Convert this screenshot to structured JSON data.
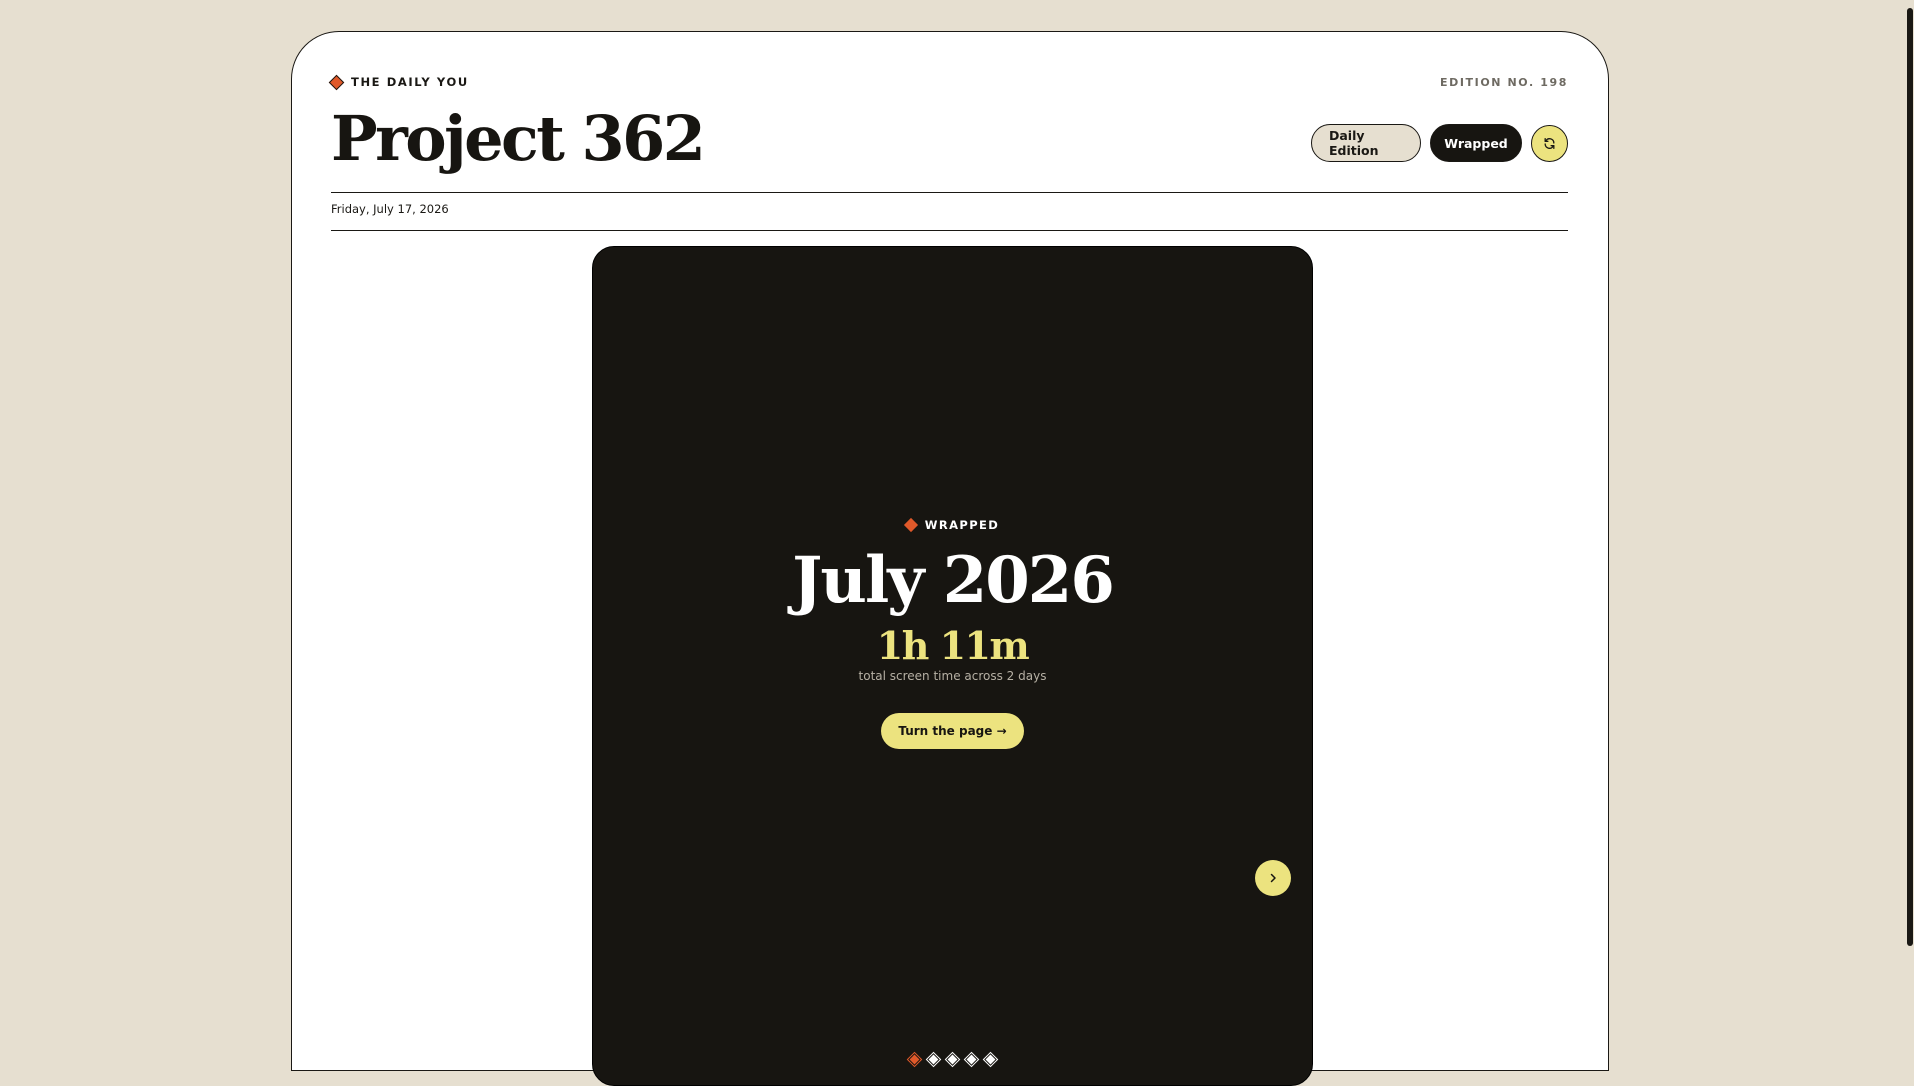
{
  "masthead": {
    "brand": "THE DAILY YOU",
    "edition": "EDITION NO. 198",
    "title": "Project 362",
    "date": "Friday, July 17, 2026"
  },
  "controls": {
    "daily_label": "Daily Edition",
    "wrapped_label": "Wrapped",
    "refresh_icon": "refresh-icon"
  },
  "card": {
    "eyebrow": "WRAPPED",
    "month": "July 2026",
    "total_time": "1h 11m",
    "subtext": "total screen time across 2 days",
    "cta_label": "Turn the page →",
    "next_icon": "chevron-right-icon",
    "pages": 5,
    "active_page": 1
  },
  "colors": {
    "background": "#e6dfd0",
    "ink": "#171511",
    "accent": "#e0592a",
    "highlight": "#ece37f"
  }
}
